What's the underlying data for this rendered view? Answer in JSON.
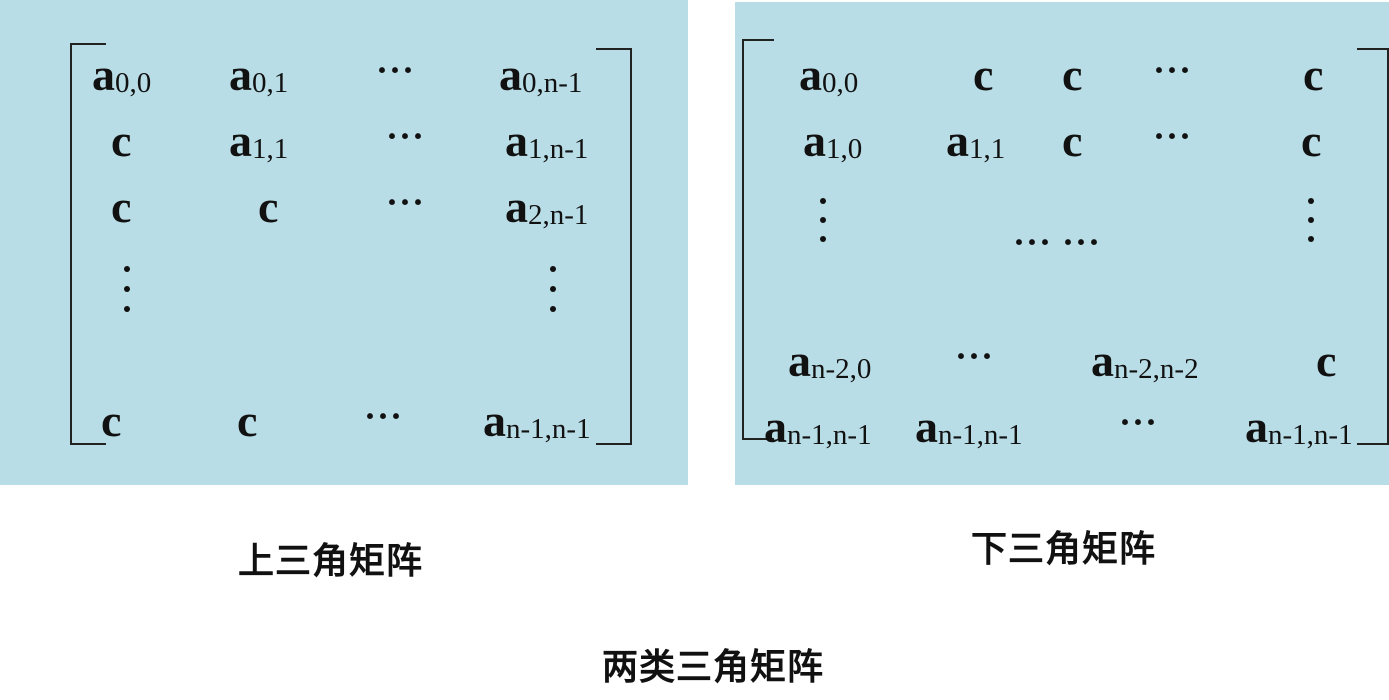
{
  "upper": {
    "caption": "上三角矩阵",
    "cells": {
      "r0c0": "a",
      "r0c0s": "0,0",
      "r0c1": "a",
      "r0c1s": "0,1",
      "r0c3": "a",
      "r0c3s": "0,n-1",
      "r1c0": "c",
      "r1c1": "a",
      "r1c1s": "1,1",
      "r1c3": "a",
      "r1c3s": "1,n-1",
      "r2c0": "c",
      "r2c1": "c",
      "r2c3": "a",
      "r2c3s": "2,n-1",
      "r5c0": "c",
      "r5c1": "c",
      "r5c3": "a",
      "r5c3s": "n-1,n-1"
    },
    "hdots": "···"
  },
  "lower": {
    "caption": "下三角矩阵",
    "cells": {
      "r0c0": "a",
      "r0c0s": "0,0",
      "r0c1": "c",
      "r0c2": "c",
      "r0c4": "c",
      "r1c0": "a",
      "r1c0s": "1,0",
      "r1c1": "a",
      "r1c1s": "1,1",
      "r1c2": "c",
      "r1c4": "c",
      "r3c0": "a",
      "r3c0s": "n-2,0",
      "r3c2": "a",
      "r3c2s": "n-2,n-2",
      "r3c4": "c",
      "r4c0": "a",
      "r4c0s": "n-1,n-1",
      "r4c1": "a",
      "r4c1s": "n-1,n-1",
      "r4c4": "a",
      "r4c4s": "n-1,n-1"
    },
    "hdots": "···",
    "middots": "··· ···"
  },
  "figure_caption": "两类三角矩阵"
}
